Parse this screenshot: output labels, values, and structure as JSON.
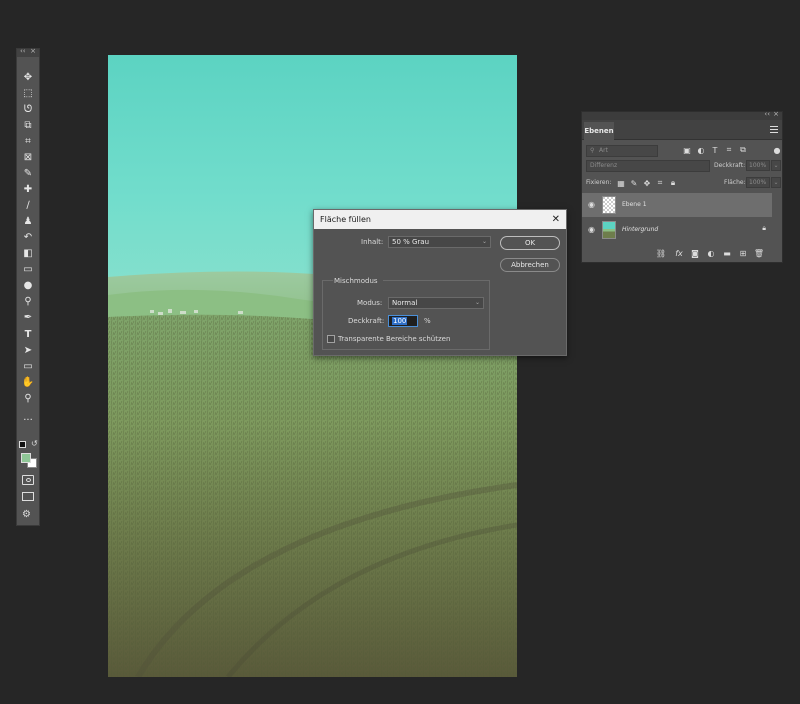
{
  "toolbar": {
    "collapse_label": "‹‹",
    "close_label": "×",
    "tools": [
      {
        "name": "move-tool-icon",
        "glyph": "✥"
      },
      {
        "name": "marquee-tool-icon",
        "glyph": "⬚"
      },
      {
        "name": "lasso-tool-icon",
        "glyph": "ᘎ"
      },
      {
        "name": "object-select-tool-icon",
        "glyph": "⧉"
      },
      {
        "name": "crop-tool-icon",
        "glyph": "⌗"
      },
      {
        "name": "frame-tool-icon",
        "glyph": "⊠"
      },
      {
        "name": "eyedropper-tool-icon",
        "glyph": "✎"
      },
      {
        "name": "healing-brush-tool-icon",
        "glyph": "✚"
      },
      {
        "name": "brush-tool-icon",
        "glyph": "∕"
      },
      {
        "name": "clone-stamp-tool-icon",
        "glyph": "♟"
      },
      {
        "name": "history-brush-tool-icon",
        "glyph": "↶"
      },
      {
        "name": "eraser-tool-icon",
        "glyph": "◧"
      },
      {
        "name": "gradient-tool-icon",
        "glyph": "▭"
      },
      {
        "name": "blur-tool-icon",
        "glyph": "●"
      },
      {
        "name": "dodge-tool-icon",
        "glyph": "⚲"
      },
      {
        "name": "pen-tool-icon",
        "glyph": "✒"
      },
      {
        "name": "type-tool-icon",
        "glyph": "T"
      },
      {
        "name": "path-select-tool-icon",
        "glyph": "➤"
      },
      {
        "name": "rectangle-tool-icon",
        "glyph": "▭"
      },
      {
        "name": "hand-tool-icon",
        "glyph": "✋"
      },
      {
        "name": "zoom-tool-icon",
        "glyph": "⚲"
      },
      {
        "name": "more-tools-icon",
        "glyph": "···"
      }
    ],
    "foreground_color": "#8fc797",
    "background_color": "#ffffff"
  },
  "layers_panel": {
    "collapse_label": "‹‹",
    "close_label": "×",
    "tab_label": "Ebenen",
    "menu_icon": "hamburger-menu-icon",
    "filter_placeholder": "Art",
    "blend_mode": "Differenz",
    "opacity_label": "Deckkraft:",
    "opacity_value": "100%",
    "lock_label": "Fixieren:",
    "fill_label": "Fläche:",
    "fill_value": "100%",
    "layers": [
      {
        "name": "Ebene 1",
        "selected": true
      },
      {
        "name": "Hintergrund",
        "selected": false
      }
    ]
  },
  "dialog": {
    "title": "Fläche füllen",
    "content_label": "Inhalt:",
    "content_value": "50 % Grau",
    "ok_label": "OK",
    "cancel_label": "Abbrechen",
    "blending_group_label": "Mischmodus",
    "mode_label": "Modus:",
    "mode_value": "Normal",
    "opacity_label": "Deckkraft:",
    "opacity_value": "100",
    "opacity_unit": "%",
    "preserve_transparency_label": "Transparente Bereiche schützen",
    "preserve_transparency_checked": false
  }
}
